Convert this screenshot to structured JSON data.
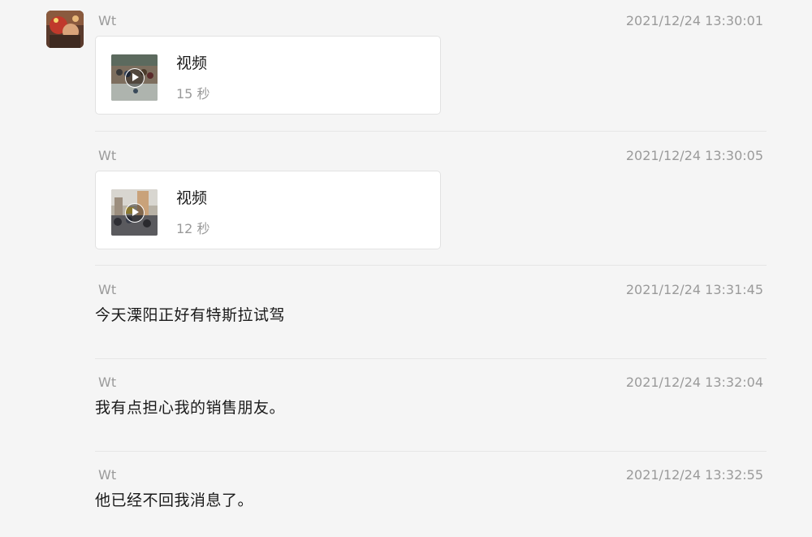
{
  "messages": [
    {
      "sender": "Wt",
      "time": "2021/12/24 13:30:01",
      "type": "video",
      "video": {
        "title": "视频",
        "duration": "15 秒"
      }
    },
    {
      "sender": "Wt",
      "time": "2021/12/24 13:30:05",
      "type": "video",
      "video": {
        "title": "视频",
        "duration": "12 秒"
      }
    },
    {
      "sender": "Wt",
      "time": "2021/12/24 13:31:45",
      "type": "text",
      "text": "今天溧阳正好有特斯拉试驾"
    },
    {
      "sender": "Wt",
      "time": "2021/12/24 13:32:04",
      "type": "text",
      "text": "我有点担心我的销售朋友。"
    },
    {
      "sender": "Wt",
      "time": "2021/12/24 13:32:55",
      "type": "text",
      "text": "他已经不回我消息了。"
    }
  ],
  "icons": {
    "play": "play-icon",
    "avatar": "user-avatar"
  },
  "colors": {
    "background": "#f5f5f5",
    "card": "#ffffff",
    "meta_text": "#9a9a9a",
    "body_text": "#1a1a1a",
    "separator": "#e6e6e6"
  }
}
